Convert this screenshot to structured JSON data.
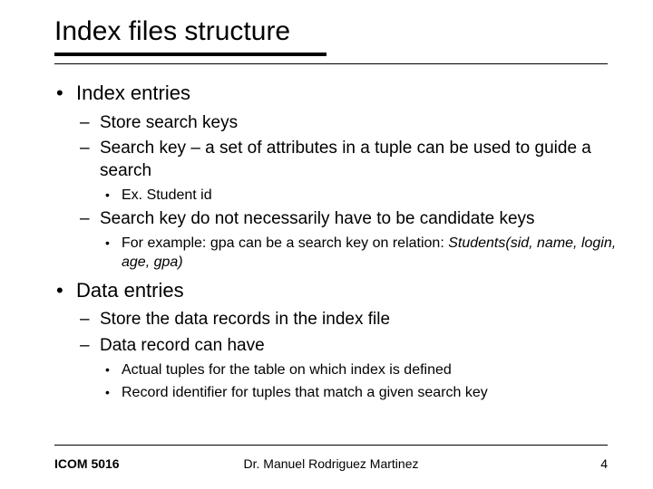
{
  "title": "Index files structure",
  "bullets": {
    "b1": "Index entries",
    "b1_1": "Store search keys",
    "b1_2": "Search key – a set of attributes in a tuple can be used to guide a search",
    "b1_2_1": "Ex. Student id",
    "b1_3": "Search key do not necessarily have to be candidate keys",
    "b1_3_1_a": "For example: gpa can be a search key on relation: ",
    "b1_3_1_b": "Students(sid, name, login, age, gpa)",
    "b2": "Data entries",
    "b2_1": "Store the data records in the index file",
    "b2_2": "Data record can have",
    "b2_2_1": "Actual tuples for the table on which index is defined",
    "b2_2_2": "Record identifier for tuples that match a given search key"
  },
  "footer": {
    "left": "ICOM 5016",
    "center": "Dr. Manuel Rodriguez Martinez",
    "right": "4"
  }
}
